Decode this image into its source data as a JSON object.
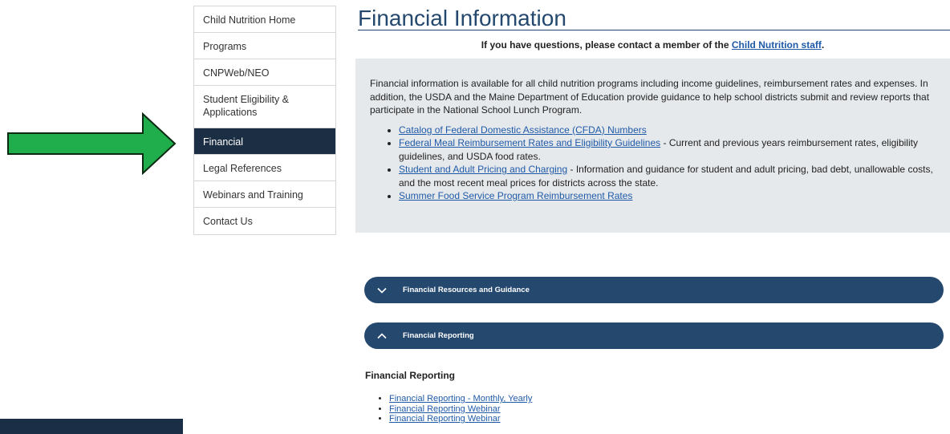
{
  "sidebar": {
    "items": [
      {
        "label": "Child Nutrition Home"
      },
      {
        "label": "Programs"
      },
      {
        "label": "CNPWeb/NEO"
      },
      {
        "label": "Student Eligibility & Applications"
      },
      {
        "label": "Financial"
      },
      {
        "label": "Legal References"
      },
      {
        "label": "Webinars and Training"
      },
      {
        "label": "Contact Us"
      }
    ]
  },
  "main": {
    "title": "Financial Information",
    "contact_prefix": "If you have questions, please contact a member of the ",
    "contact_link": "Child Nutrition staff",
    "contact_suffix": ".",
    "intro": "Financial information is available for all child nutrition programs including income guidelines, reimbursement rates and expenses. In addition, the USDA and the Maine Department of Education provide guidance to help school districts submit and review reports that participate in the National School Lunch Program.",
    "links": [
      {
        "link": "Catalog of Federal Domestic Assistance (CFDA) Numbers",
        "desc": ""
      },
      {
        "link": "Federal Meal Reimbursement Rates and Eligibility Guidelines",
        "desc": " - Current and previous years reimbursement rates, eligibility guidelines, and USDA food rates."
      },
      {
        "link": "Student and Adult Pricing and Charging",
        "desc": " - Information and guidance for student and adult pricing, bad debt, unallowable costs, and the most recent meal prices for districts across the state."
      },
      {
        "link": "Summer Food Service Program Reimbursement Rates",
        "desc": ""
      }
    ]
  },
  "accordion": {
    "section1": "Financial Resources and Guidance",
    "section2": "Financial Reporting"
  },
  "reporting": {
    "heading": "Financial Reporting",
    "links": [
      "Financial Reporting - Monthly, Yearly",
      "Financial Reporting Webinar",
      "Financial Reporting Webinar"
    ]
  },
  "icons": {
    "arrow": "right-arrow-icon",
    "expand": "chevron-down-icon",
    "collapse": "chevron-up-icon"
  },
  "colors": {
    "arrow_fill": "#1fae4b",
    "nav_active": "#1b2e44",
    "accordion": "#24486e",
    "link": "#1f5aa8",
    "info_box": "#e6e9ec"
  }
}
